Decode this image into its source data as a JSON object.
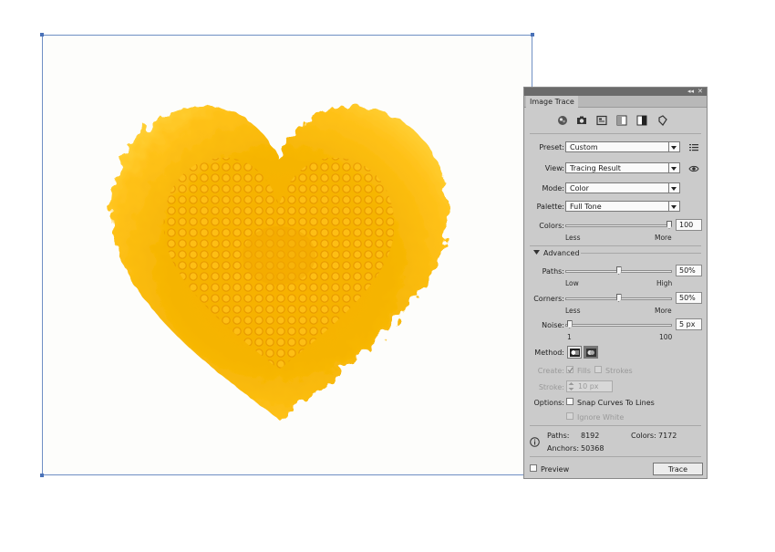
{
  "panel": {
    "title": "Image Trace",
    "titlebar_controls": {
      "collapse": "◂◂",
      "close": "✕"
    },
    "icons": [
      "auto-color-icon",
      "camera-icon",
      "presentation-icon",
      "grayscale-icon",
      "black-white-icon",
      "outline-icon"
    ],
    "preset": {
      "label": "Preset:",
      "value": "Custom"
    },
    "view": {
      "label": "View:",
      "value": "Tracing Result"
    },
    "mode": {
      "label": "Mode:",
      "value": "Color"
    },
    "palette": {
      "label": "Palette:",
      "value": "Full Tone"
    },
    "colors": {
      "label": "Colors:",
      "value": "100",
      "min_label": "Less",
      "max_label": "More",
      "level": 1.0
    },
    "advanced": {
      "label": "Advanced"
    },
    "paths": {
      "label": "Paths:",
      "value": "50%",
      "min_label": "Low",
      "max_label": "High",
      "level": 0.5
    },
    "corners": {
      "label": "Corners:",
      "value": "50%",
      "min_label": "Less",
      "max_label": "More",
      "level": 0.5
    },
    "noise": {
      "label": "Noise:",
      "value": "5 px",
      "min_label": "1",
      "max_label": "100",
      "level": 0.04
    },
    "method": {
      "label": "Method:"
    },
    "create": {
      "label": "Create:",
      "fills": "Fills",
      "strokes": "Strokes",
      "fills_checked": true,
      "strokes_checked": false
    },
    "stroke": {
      "label": "Stroke:",
      "value": "10 px"
    },
    "options": {
      "label": "Options:",
      "snap": "Snap Curves To Lines",
      "ignore_white": "Ignore White"
    },
    "stats": {
      "paths_label": "Paths:",
      "paths_value": "8192",
      "colors_label": "Colors:",
      "colors_value": "7172",
      "anchors_label": "Anchors:",
      "anchors_value": "50368"
    },
    "preview": {
      "label": "Preview",
      "checked": false
    },
    "trace_button": "Trace"
  },
  "colors": {
    "heart_main": "#f5b400",
    "heart_dark": "#e39200",
    "heart_light": "#ffd23a",
    "panel_bg": "#cbcbcb",
    "artboard_border": "#6f8fc4"
  }
}
